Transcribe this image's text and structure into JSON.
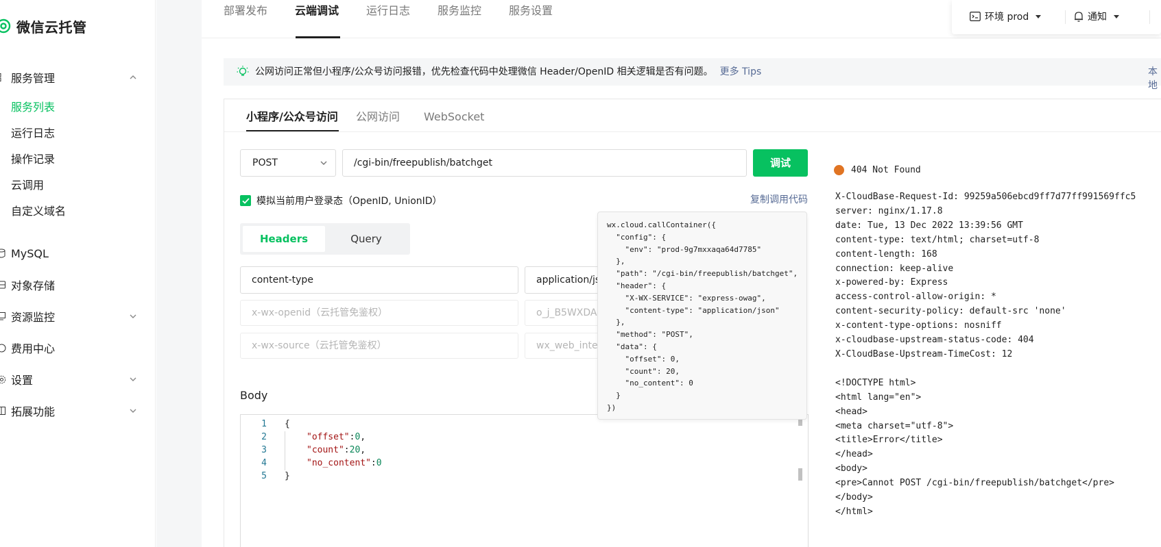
{
  "brand": {
    "name": "微信云托管"
  },
  "sidebar": {
    "groups": [
      {
        "label": "服务管理",
        "icon": "apps-icon"
      },
      {
        "label": "MySQL",
        "icon": "database-icon"
      },
      {
        "label": "对象存储",
        "icon": "storage-icon"
      },
      {
        "label": "资源监控",
        "icon": "monitor-icon"
      },
      {
        "label": "费用中心",
        "icon": "billing-icon"
      },
      {
        "label": "设置",
        "icon": "gear-icon"
      },
      {
        "label": "拓展功能",
        "icon": "extension-icon"
      }
    ],
    "service_items": [
      "服务列表",
      "运行日志",
      "操作记录",
      "云调用",
      "自定义域名"
    ]
  },
  "top_tabs": [
    "部署发布",
    "云端调试",
    "运行日志",
    "服务监控",
    "服务设置"
  ],
  "env": {
    "label": "环境 prod"
  },
  "notice": {
    "label": "通知"
  },
  "tips": {
    "text": "公网访问正常但小程序/公众号访问报错，优先检查代码中处理微信 Header/OpenID 相关逻辑是否有问题。",
    "link": "更多 Tips",
    "right_cut": "本地"
  },
  "sub_tabs": [
    "小程序/公众号访问",
    "公网访问",
    "WebSocket"
  ],
  "request": {
    "method": "POST",
    "path": "/cgi-bin/freepublish/batchget",
    "debug_button": "调试",
    "simulate_login": "模拟当前用户登录态（OpenID, UnionID）",
    "copy_code": "复制调用代码"
  },
  "param_tabs": [
    "Headers",
    "Query"
  ],
  "headers": [
    {
      "key": "content-type",
      "value": "application/json"
    },
    {
      "key_placeholder": "x-wx-openid（云托管免鉴权）",
      "value_placeholder": "o_j_B5WXDAb"
    },
    {
      "key_placeholder": "x-wx-source（云托管免鉴权）",
      "value_placeholder": "wx_web_interna"
    }
  ],
  "body": {
    "label": "Body",
    "line_numbers": [
      "1",
      "2",
      "3",
      "4",
      "5"
    ],
    "lines": {
      "l1": "{",
      "l2_key": "\"offset\"",
      "l2_val": "0",
      "l3_key": "\"count\"",
      "l3_val": "20",
      "l4_key": "\"no_content\"",
      "l4_val": "0",
      "l5": "}"
    }
  },
  "call_code": "wx.cloud.callContainer({\n  \"config\": {\n    \"env\": \"prod-9g7mxxaqa64d7785\"\n  },\n  \"path\": \"/cgi-bin/freepublish/batchget\",\n  \"header\": {\n    \"X-WX-SERVICE\": \"express-owag\",\n    \"content-type\": \"application/json\"\n  },\n  \"method\": \"POST\",\n  \"data\": {\n    \"offset\": 0,\n    \"count\": 20,\n    \"no_content\": 0\n  }\n})",
  "response": {
    "status": "404 Not Found",
    "status_color": "#e07423",
    "text": "X-CloudBase-Request-Id: 99259a506ebcd9ff7d77ff991569ffc5\nserver: nginx/1.17.8\ndate: Tue, 13 Dec 2022 13:39:56 GMT\ncontent-type: text/html; charset=utf-8\ncontent-length: 168\nconnection: keep-alive\nx-powered-by: Express\naccess-control-allow-origin: *\ncontent-security-policy: default-src 'none'\nx-content-type-options: nosniff\nx-cloudbase-upstream-status-code: 404\nX-CloudBase-Upstream-TimeCost: 12\n\n<!DOCTYPE html>\n<html lang=\"en\">\n<head>\n<meta charset=\"utf-8\">\n<title>Error</title>\n</head>\n<body>\n<pre>Cannot POST /cgi-bin/freepublish/batchget</pre>\n</body>\n</html>"
  },
  "colors": {
    "accent": "#07c160",
    "link": "#576b95"
  }
}
